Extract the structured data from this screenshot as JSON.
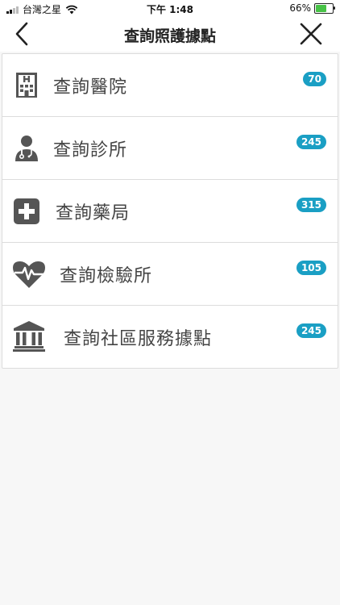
{
  "status_bar": {
    "carrier": "台灣之星",
    "time": "下午 1:48",
    "battery": "66%"
  },
  "nav": {
    "title": "查詢照護據點"
  },
  "items": [
    {
      "label": "查詢醫院",
      "count": "70",
      "icon": "hospital-building-icon"
    },
    {
      "label": "查詢診所",
      "count": "245",
      "icon": "doctor-icon"
    },
    {
      "label": "查詢藥局",
      "count": "315",
      "icon": "medical-cross-icon"
    },
    {
      "label": "查詢檢驗所",
      "count": "105",
      "icon": "heartbeat-icon"
    },
    {
      "label": "查詢社區服務據點",
      "count": "245",
      "icon": "institution-building-icon"
    }
  ],
  "colors": {
    "badge": "#1a9fc4",
    "icon": "#555555",
    "battery": "#47c246"
  }
}
